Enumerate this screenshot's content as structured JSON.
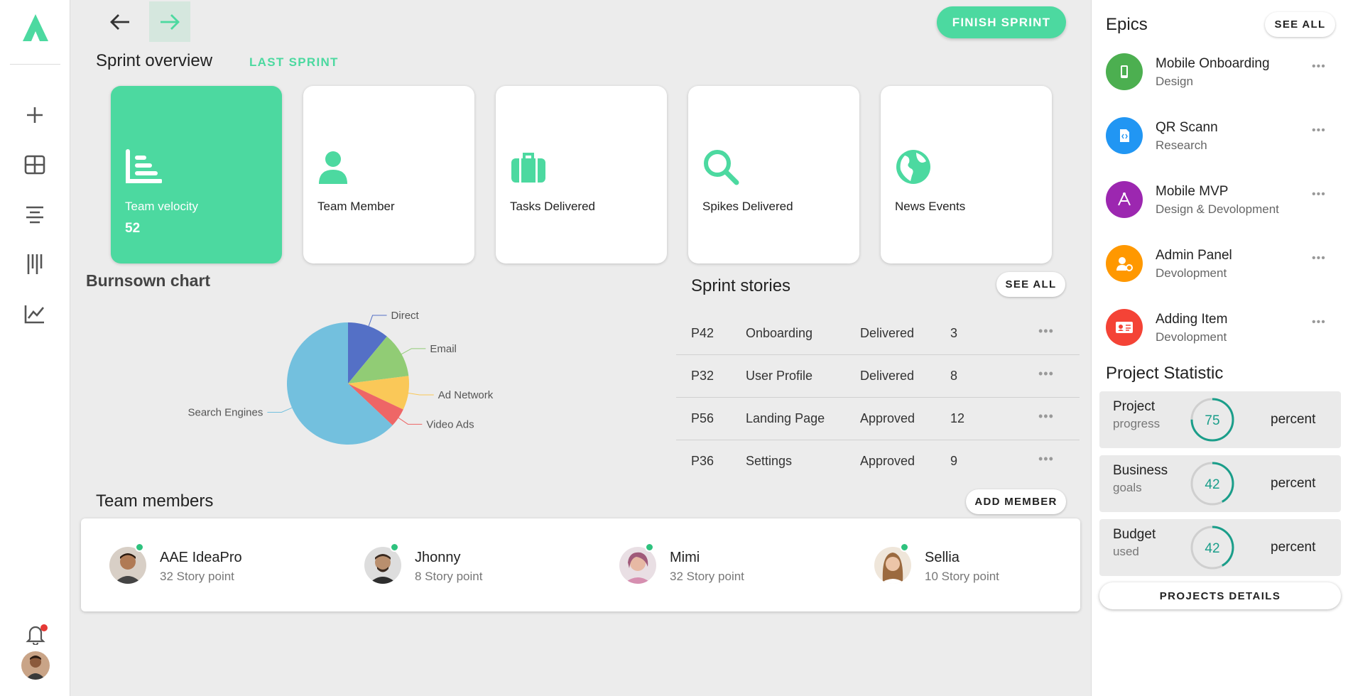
{
  "header": {
    "finish_label": "FINISH SPRINT"
  },
  "overview": {
    "title": "Sprint overview",
    "last_sprint": "LAST SPRINT",
    "cards": [
      {
        "label": "Team velocity",
        "value": "52",
        "icon": "bar-chart-icon"
      },
      {
        "label": "Team Member",
        "icon": "person-icon"
      },
      {
        "label": "Tasks Delivered",
        "icon": "briefcase-icon"
      },
      {
        "label": "Spikes Delivered",
        "icon": "search-icon"
      },
      {
        "label": "News Events",
        "icon": "globe-icon"
      }
    ]
  },
  "chart_data": {
    "type": "pie",
    "title": "Burnsown chart",
    "labels": [
      "Direct",
      "Email",
      "Ad Network",
      "Video Ads",
      "Search Engines"
    ],
    "values": [
      11,
      12,
      9,
      5,
      63
    ],
    "colors": [
      "#5470c6",
      "#91cc75",
      "#fac858",
      "#ee6666",
      "#73c0de"
    ]
  },
  "stories": {
    "title": "Sprint stories",
    "see_all": "SEE ALL",
    "rows": [
      {
        "id": "P42",
        "name": "Onboarding",
        "status": "Delivered",
        "points": "3"
      },
      {
        "id": "P32",
        "name": "User Profile",
        "status": "Delivered",
        "points": "8"
      },
      {
        "id": "P56",
        "name": "Landing Page",
        "status": "Approved",
        "points": "12"
      },
      {
        "id": "P36",
        "name": "Settings",
        "status": "Approved",
        "points": "9"
      }
    ],
    "more_glyph": "•••"
  },
  "team": {
    "title": "Team members",
    "add_label": "ADD MEMBER",
    "members": [
      {
        "name": "AAE IdeaPro",
        "points": "32 Story point"
      },
      {
        "name": "Jhonny",
        "points": "8 Story point"
      },
      {
        "name": "Mimi",
        "points": "32 Story point"
      },
      {
        "name": "Sellia",
        "points": "10 Story point"
      }
    ]
  },
  "epics": {
    "title": "Epics",
    "see_all": "SEE ALL",
    "items": [
      {
        "name": "Mobile Onboarding",
        "sub": "Design",
        "color": "#4caf50",
        "icon": "phone-icon"
      },
      {
        "name": "QR Scann",
        "sub": "Research",
        "color": "#2196f3",
        "icon": "code-file-icon"
      },
      {
        "name": "Mobile MVP",
        "sub": "Design & Devolopment",
        "color": "#9c27b0",
        "icon": "design-icon"
      },
      {
        "name": "Admin Panel",
        "sub": "Devolopment",
        "color": "#ff9800",
        "icon": "user-settings-icon"
      },
      {
        "name": "Adding Item",
        "sub": "Devolopment",
        "color": "#f44336",
        "icon": "id-card-icon"
      }
    ]
  },
  "project_statistic": {
    "title": "Project Statistic",
    "items": [
      {
        "l1": "Project",
        "l2": "progress",
        "value": "75",
        "unit": "percent",
        "fraction": 0.75
      },
      {
        "l1": "Business",
        "l2": "goals",
        "value": "42",
        "unit": "percent",
        "fraction": 0.42
      },
      {
        "l1": "Budget",
        "l2": "used",
        "value": "42",
        "unit": "percent",
        "fraction": 0.42
      }
    ],
    "details_label": "PROJECTS DETAILS"
  },
  "colors": {
    "accent": "#4cd9a0",
    "ring": "#1a9e8a",
    "online": "#2ec27e"
  }
}
